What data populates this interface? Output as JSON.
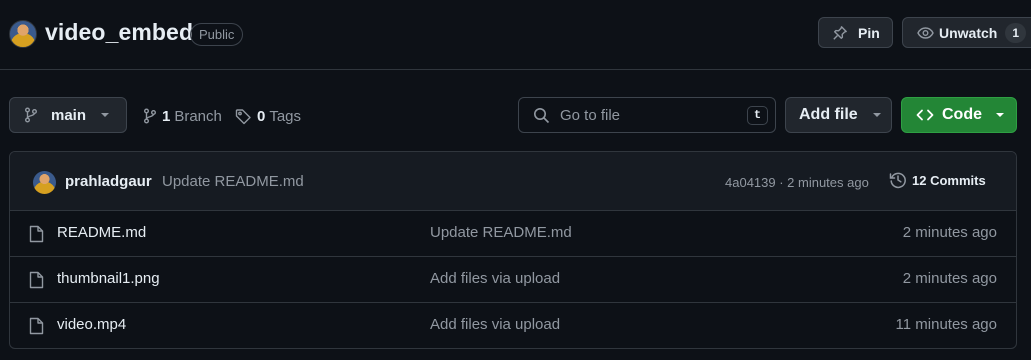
{
  "repo": {
    "name": "video_embed",
    "visibility": "Public"
  },
  "header_actions": {
    "pin_label": "Pin",
    "unwatch_label": "Unwatch",
    "watch_count": "1"
  },
  "toolbar": {
    "branch": "main",
    "branches_count": "1",
    "branches_label": "Branch",
    "tags_count": "0",
    "tags_label": "Tags",
    "goto_placeholder": "Go to file",
    "goto_shortcut": "t",
    "add_file_label": "Add file",
    "code_label": "Code"
  },
  "latest_commit": {
    "author": "prahladgaur",
    "message": "Update README.md",
    "hash_time": "4a04139 · 2 minutes ago",
    "commits_label": "12 Commits"
  },
  "files": [
    {
      "name": "README.md",
      "commit": "Update README.md",
      "time": "2 minutes ago"
    },
    {
      "name": "thumbnail1.png",
      "commit": "Add files via upload",
      "time": "2 minutes ago"
    },
    {
      "name": "video.mp4",
      "commit": "Add files via upload",
      "time": "11 minutes ago"
    }
  ],
  "colors": {
    "background": "#0d1117",
    "code_button": "#238636",
    "border": "#30363d",
    "muted_text": "#9198a1"
  },
  "icons": [
    "pin-icon",
    "eye-icon",
    "branch-icon",
    "tag-icon",
    "search-icon",
    "code-icon",
    "history-icon",
    "file-icon",
    "caret-down-icon"
  ]
}
